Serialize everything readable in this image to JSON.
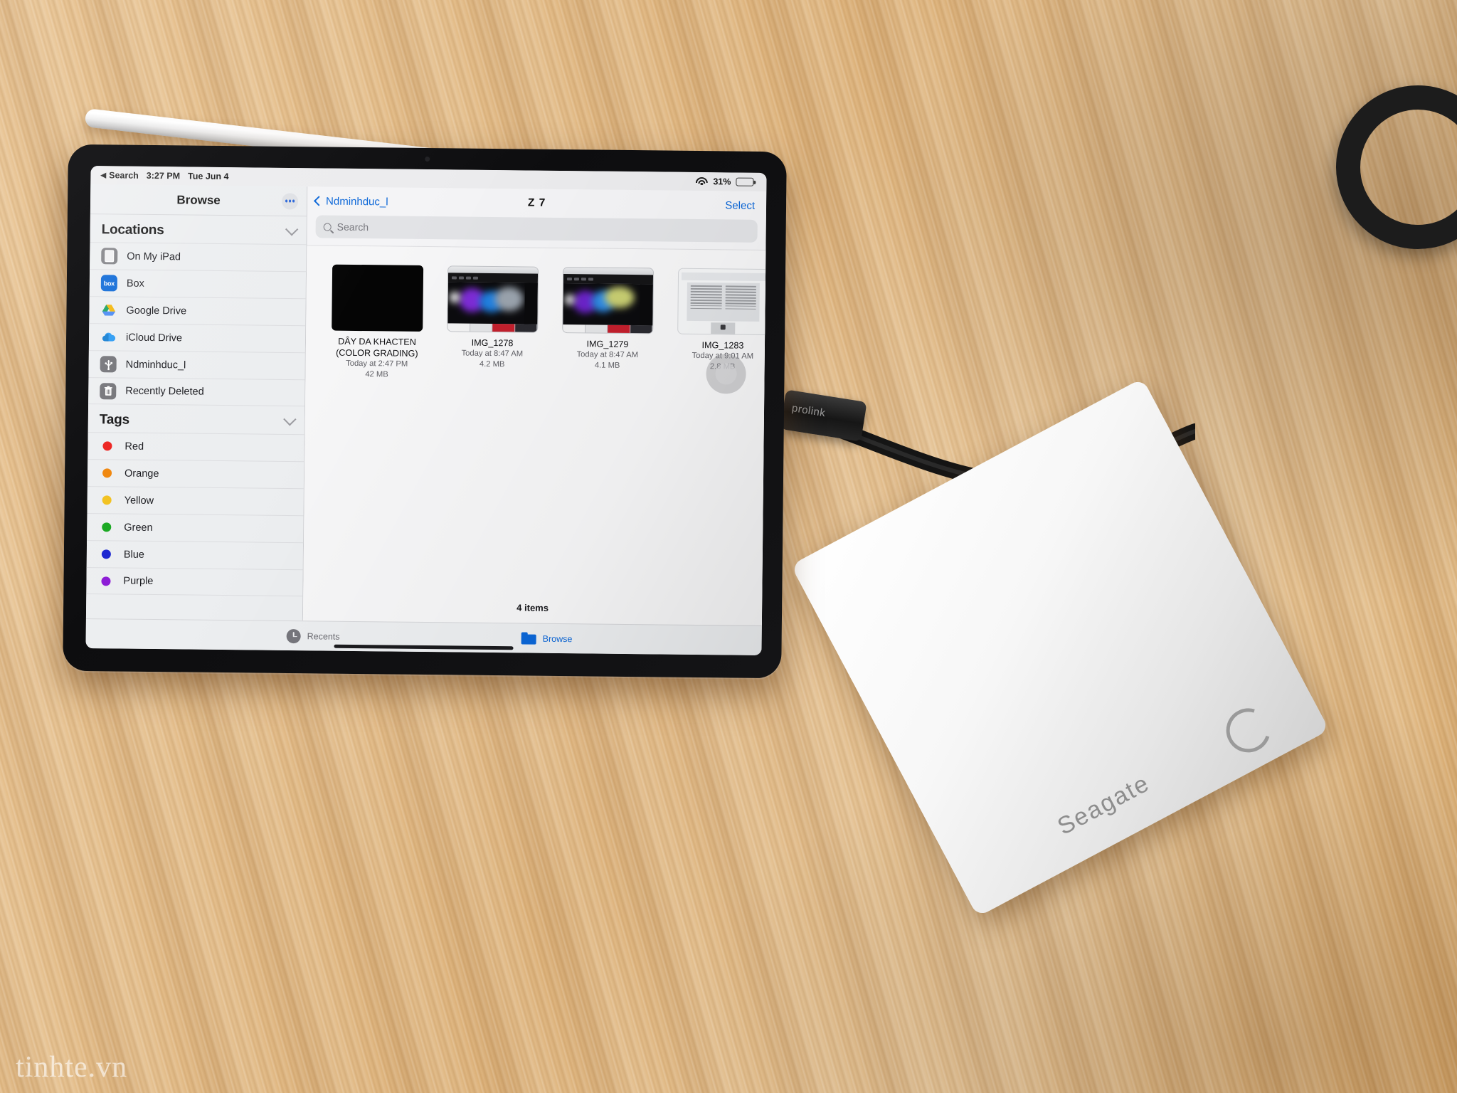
{
  "status_bar": {
    "back_label": "Search",
    "time": "3:27 PM",
    "date": "Tue Jun 4",
    "wifi_icon": "wifi-icon",
    "battery_percent": "31%",
    "battery_level": 31
  },
  "sidebar": {
    "title": "Browse",
    "more_icon": "ellipsis-icon",
    "sections": [
      {
        "heading": "Locations",
        "collapse_icon": "chevron-down-icon",
        "items": [
          {
            "label": "On My iPad",
            "icon": "ipad-icon"
          },
          {
            "label": "Box",
            "icon": "box-app-icon"
          },
          {
            "label": "Google Drive",
            "icon": "google-drive-icon"
          },
          {
            "label": "iCloud Drive",
            "icon": "icloud-icon"
          },
          {
            "label": "Ndminhduc_l",
            "icon": "usb-drive-icon"
          },
          {
            "label": "Recently Deleted",
            "icon": "trash-icon"
          }
        ]
      },
      {
        "heading": "Tags",
        "collapse_icon": "chevron-down-icon",
        "items": [
          {
            "label": "Red",
            "color": "#ec1c18"
          },
          {
            "label": "Orange",
            "color": "#ef8204"
          },
          {
            "label": "Yellow",
            "color": "#f2c019"
          },
          {
            "label": "Green",
            "color": "#13a61b"
          },
          {
            "label": "Blue",
            "color": "#1520cf"
          },
          {
            "label": "Purple",
            "color": "#8a16d5"
          }
        ]
      }
    ]
  },
  "main": {
    "back_label": "Ndminhduc_l",
    "back_icon": "chevron-left-icon",
    "title": "Z 7",
    "select_label": "Select",
    "search": {
      "placeholder": "Search",
      "icon": "search-icon",
      "value": ""
    },
    "files": [
      {
        "name_line1": "DÂY DA KHACTEN",
        "name_line2": "(COLOR GRADING)",
        "date": "Today at 2:47 PM",
        "size": "42 MB",
        "thumb": "black-video-thumb"
      },
      {
        "name_line1": "IMG_1278",
        "name_line2": "",
        "date": "Today at 8:47 AM",
        "size": "4.2 MB",
        "thumb": "screenshot-thumb"
      },
      {
        "name_line1": "IMG_1279",
        "name_line2": "",
        "date": "Today at 8:47 AM",
        "size": "4.1 MB",
        "thumb": "screenshot-thumb"
      },
      {
        "name_line1": "IMG_1283",
        "name_line2": "",
        "date": "Today at 9:01 AM",
        "size": "2.8 MB",
        "thumb": "document-thumb"
      }
    ],
    "items_count": "4 items",
    "assistive_touch_icon": "assistive-touch-icon"
  },
  "tab_bar": {
    "tabs": [
      {
        "label": "Recents",
        "icon": "clock-icon",
        "selected": false
      },
      {
        "label": "Browse",
        "icon": "folder-icon",
        "selected": true
      }
    ]
  },
  "scene": {
    "watermark": "tinhte.vn",
    "usb_plug_label": "prolink",
    "drive_brand": "Seagate"
  },
  "colors": {
    "accent_blue": "#0a66d8",
    "sidebar_bg": "#eceef0",
    "content_bg": "#f6f6f7"
  }
}
